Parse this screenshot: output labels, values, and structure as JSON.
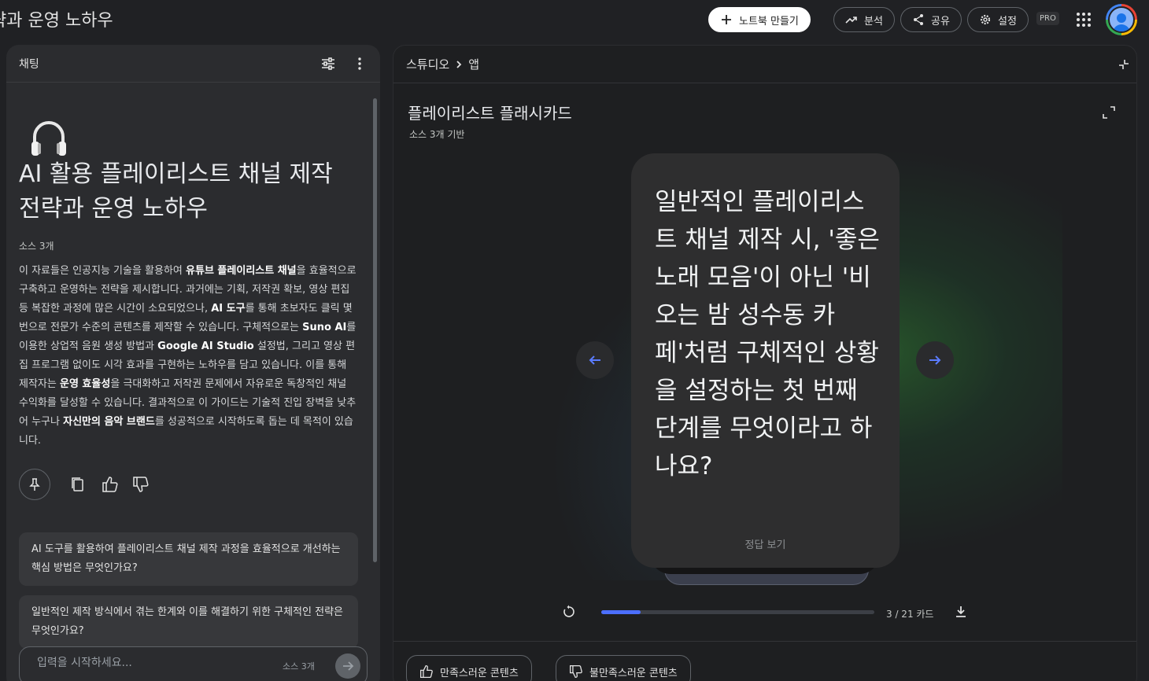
{
  "topbar": {
    "notebook_title": "략과 운영 노하우",
    "create_notebook": "노트북 만들기",
    "analytics": "분석",
    "share": "공유",
    "settings": "설정",
    "pro_badge": "PRO"
  },
  "chat": {
    "panel_title": "채팅",
    "title": "AI 활용 플레이리스트 채널 제작 전략과 운영 노하우",
    "source_count": "소스 3개",
    "summary_parts": [
      {
        "t": "이 자료들은 인공지능 기술을 활용하여 ",
        "b": false
      },
      {
        "t": "유튜브 플레이리스트 채널",
        "b": true
      },
      {
        "t": "을 효율적으로 구축하고 운영하는 전략을 제시합니다. 과거에는 기획, 저작권 확보, 영상 편집 등 복잡한 과정에 많은 시간이 소요되었으나, ",
        "b": false
      },
      {
        "t": "AI 도구",
        "b": true
      },
      {
        "t": "를 통해 초보자도 클릭 몇 번으로 전문가 수준의 콘텐츠를 제작할 수 있습니다. 구체적으로는 ",
        "b": false
      },
      {
        "t": "Suno AI",
        "b": true
      },
      {
        "t": "를 이용한 상업적 음원 생성 방법과 ",
        "b": false
      },
      {
        "t": "Google AI Studio",
        "b": true
      },
      {
        "t": " 설정법, 그리고 영상 편집 프로그램 없이도 시각 효과를 구현하는 노하우를 담고 있습니다. 이를 통해 제작자는 ",
        "b": false
      },
      {
        "t": "운영 효율성",
        "b": true
      },
      {
        "t": "을 극대화하고 저작권 문제에서 자유로운 독창적인 채널 수익화를 달성할 수 있습니다. 결과적으로 이 가이드는 기술적 진입 장벽을 낮추어 누구나 ",
        "b": false
      },
      {
        "t": "자신만의 음악 브랜드",
        "b": true
      },
      {
        "t": "를 성공적으로 시작하도록 돕는 데 목적이 있습니다.",
        "b": false
      }
    ],
    "suggestions": [
      "AI 도구를 활용하여 플레이리스트 채널 제작 과정을 효율적으로 개선하는 핵심 방법은 무엇인가요?",
      "일반적인 제작 방식에서 겪는 한계와 이를 해결하기 위한 구체적인 전략은 무엇인가요?"
    ],
    "input_placeholder": "입력을 시작하세요...",
    "input_sources": "소스 3개"
  },
  "studio": {
    "breadcrumb_root": "스튜디오",
    "breadcrumb_current": "앱",
    "title": "플레이리스트 플래시카드",
    "subtitle": "소스 3개 기반",
    "card_question": "일반적인 플레이리스트 채널 제작 시, '좋은 노래 모음'이 아닌 '비 오는 밤 성수동 카페'처럼 구체적인 상황을 설정하는 첫 번째 단계를 무엇이라고 하나요?",
    "card_answer_label": "정답 보기",
    "progress": {
      "current": 3,
      "total": 21,
      "label": "3 / 21 카드"
    },
    "feedback_good": "만족스러운 콘텐츠",
    "feedback_bad": "불만족스러운 콘텐츠"
  },
  "colors": {
    "accent": "#4c6fff",
    "glow": "#2e7d32",
    "background": "#202124"
  }
}
